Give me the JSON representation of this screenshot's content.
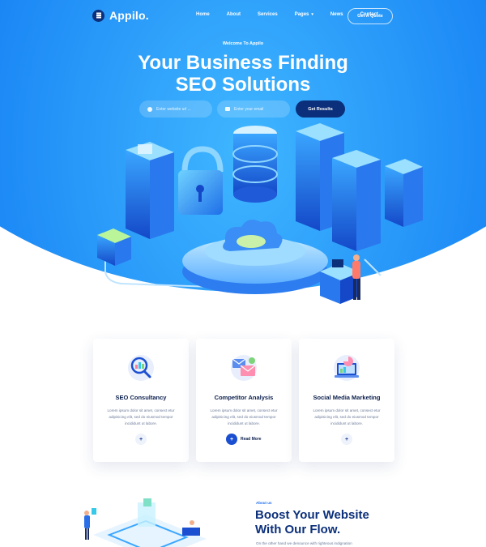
{
  "brand": {
    "name": "Appilo."
  },
  "nav": {
    "items": [
      {
        "label": "Home"
      },
      {
        "label": "About"
      },
      {
        "label": "Services"
      },
      {
        "label": "Pages",
        "has_dropdown": true
      },
      {
        "label": "News"
      },
      {
        "label": "Contact"
      }
    ],
    "cta_label": "Get A Quote"
  },
  "hero": {
    "eyebrow": "Welcome To Appilo",
    "title_line1": "Your Business Finding",
    "title_line2": "SEO Solutions",
    "website_placeholder": "Enter website url ...",
    "email_placeholder": "Enter your email",
    "submit_label": "Get Results"
  },
  "services": [
    {
      "title": "SEO Consultancy",
      "text": "Lorem ipsum dolor sit amet, consect etur adipisicing elit, sed do eiusmod tempor incididunt ut labore.",
      "icon": "seo-magnifier-icon",
      "button": "plus"
    },
    {
      "title": "Competitor Analysis",
      "text": "Lorem ipsum dolor sit amet, consect etur adipisicing elit, sed do eiusmod tempor incididunt ut labore.",
      "icon": "mail-analysis-icon",
      "button_label": "Read More"
    },
    {
      "title": "Social Media Marketing",
      "text": "Lorem ipsum dolor sit amet, consect etur adipisicing elit, sed do eiusmod tempor incididunt ut labore.",
      "icon": "social-laptop-icon",
      "button": "plus"
    }
  ],
  "about": {
    "tag": "About us",
    "title_line1": "Boost Your Website",
    "title_line2": "With Our Flow.",
    "text": "On the other hand we denounce with righteous indignation"
  },
  "colors": {
    "hero_blue": "#1a86f5",
    "navy": "#0b2f7a",
    "accent_blue": "#1b4fd1"
  }
}
